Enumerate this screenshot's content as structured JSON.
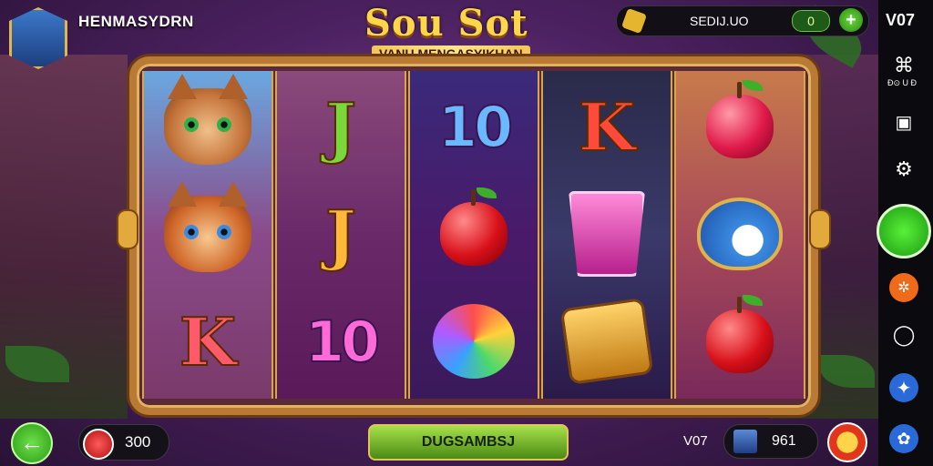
{
  "header": {
    "player_name": "HENMASYDRN",
    "title": "Sou Sot",
    "subtitle": "VANU MENGASYIKHAN"
  },
  "coins": {
    "label": "SEDIJ.UO",
    "value": "0"
  },
  "reels": [
    {
      "symbols": [
        "cat-icon",
        "cat-icon",
        "K"
      ]
    },
    {
      "symbols": [
        "J",
        "J",
        "10"
      ]
    },
    {
      "symbols": [
        "10",
        "apple-icon",
        "orb-icon"
      ]
    },
    {
      "symbols": [
        "K",
        "cup-icon",
        "device-icon"
      ]
    },
    {
      "symbols": [
        "apple-icon",
        "bird-icon",
        "apple-icon"
      ]
    }
  ],
  "bottom": {
    "bet_value": "300",
    "spin_label": "DUGSAMBSJ",
    "level_label": "V07",
    "level_value": "961"
  },
  "sidebar": {
    "version": "V07",
    "sublabel": "Ð⊙ U Ð"
  },
  "colors": {
    "accent_gold": "#e3b35c",
    "spin_green": "#6ab82a",
    "sidebar_bg": "#0b0a0e"
  }
}
